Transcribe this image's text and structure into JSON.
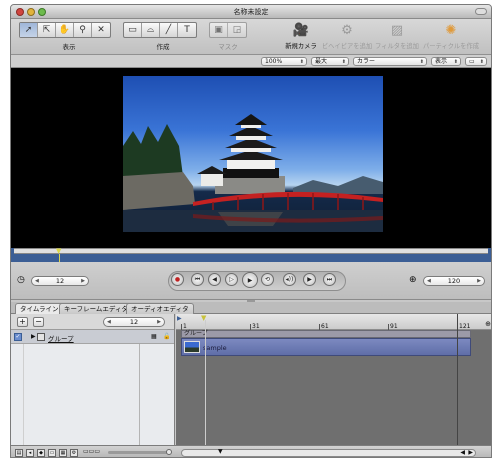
{
  "window": {
    "title": "名称未設定"
  },
  "toolbar": {
    "view_label": "表示",
    "create_label": "作成",
    "mask_label": "マスク",
    "new_camera": "新規カメラ",
    "add_behavior": "ビヘイビアを追加",
    "add_filter": "フィルタを追加",
    "add_particle": "パーティクルを作成"
  },
  "canvas_bar": {
    "zoom": "100%",
    "resolution": "最大",
    "channel": "カラー",
    "view_menu": "表示"
  },
  "transport": {
    "current_frame": "12",
    "end_frame": "120"
  },
  "tabs": [
    "タイムライン",
    "キーフレームエディタ",
    "オーディオエディタ"
  ],
  "layers": {
    "frame_field": "12",
    "group_name": "グループ"
  },
  "timeline": {
    "ruler_labels": [
      "1",
      "31",
      "61",
      "91",
      "121"
    ],
    "group_bar_label": "グループ",
    "clip_label": "sample"
  },
  "colors": {
    "accent": "#3b5e95",
    "clip": "#6b79b4",
    "canvas": "#000000"
  }
}
